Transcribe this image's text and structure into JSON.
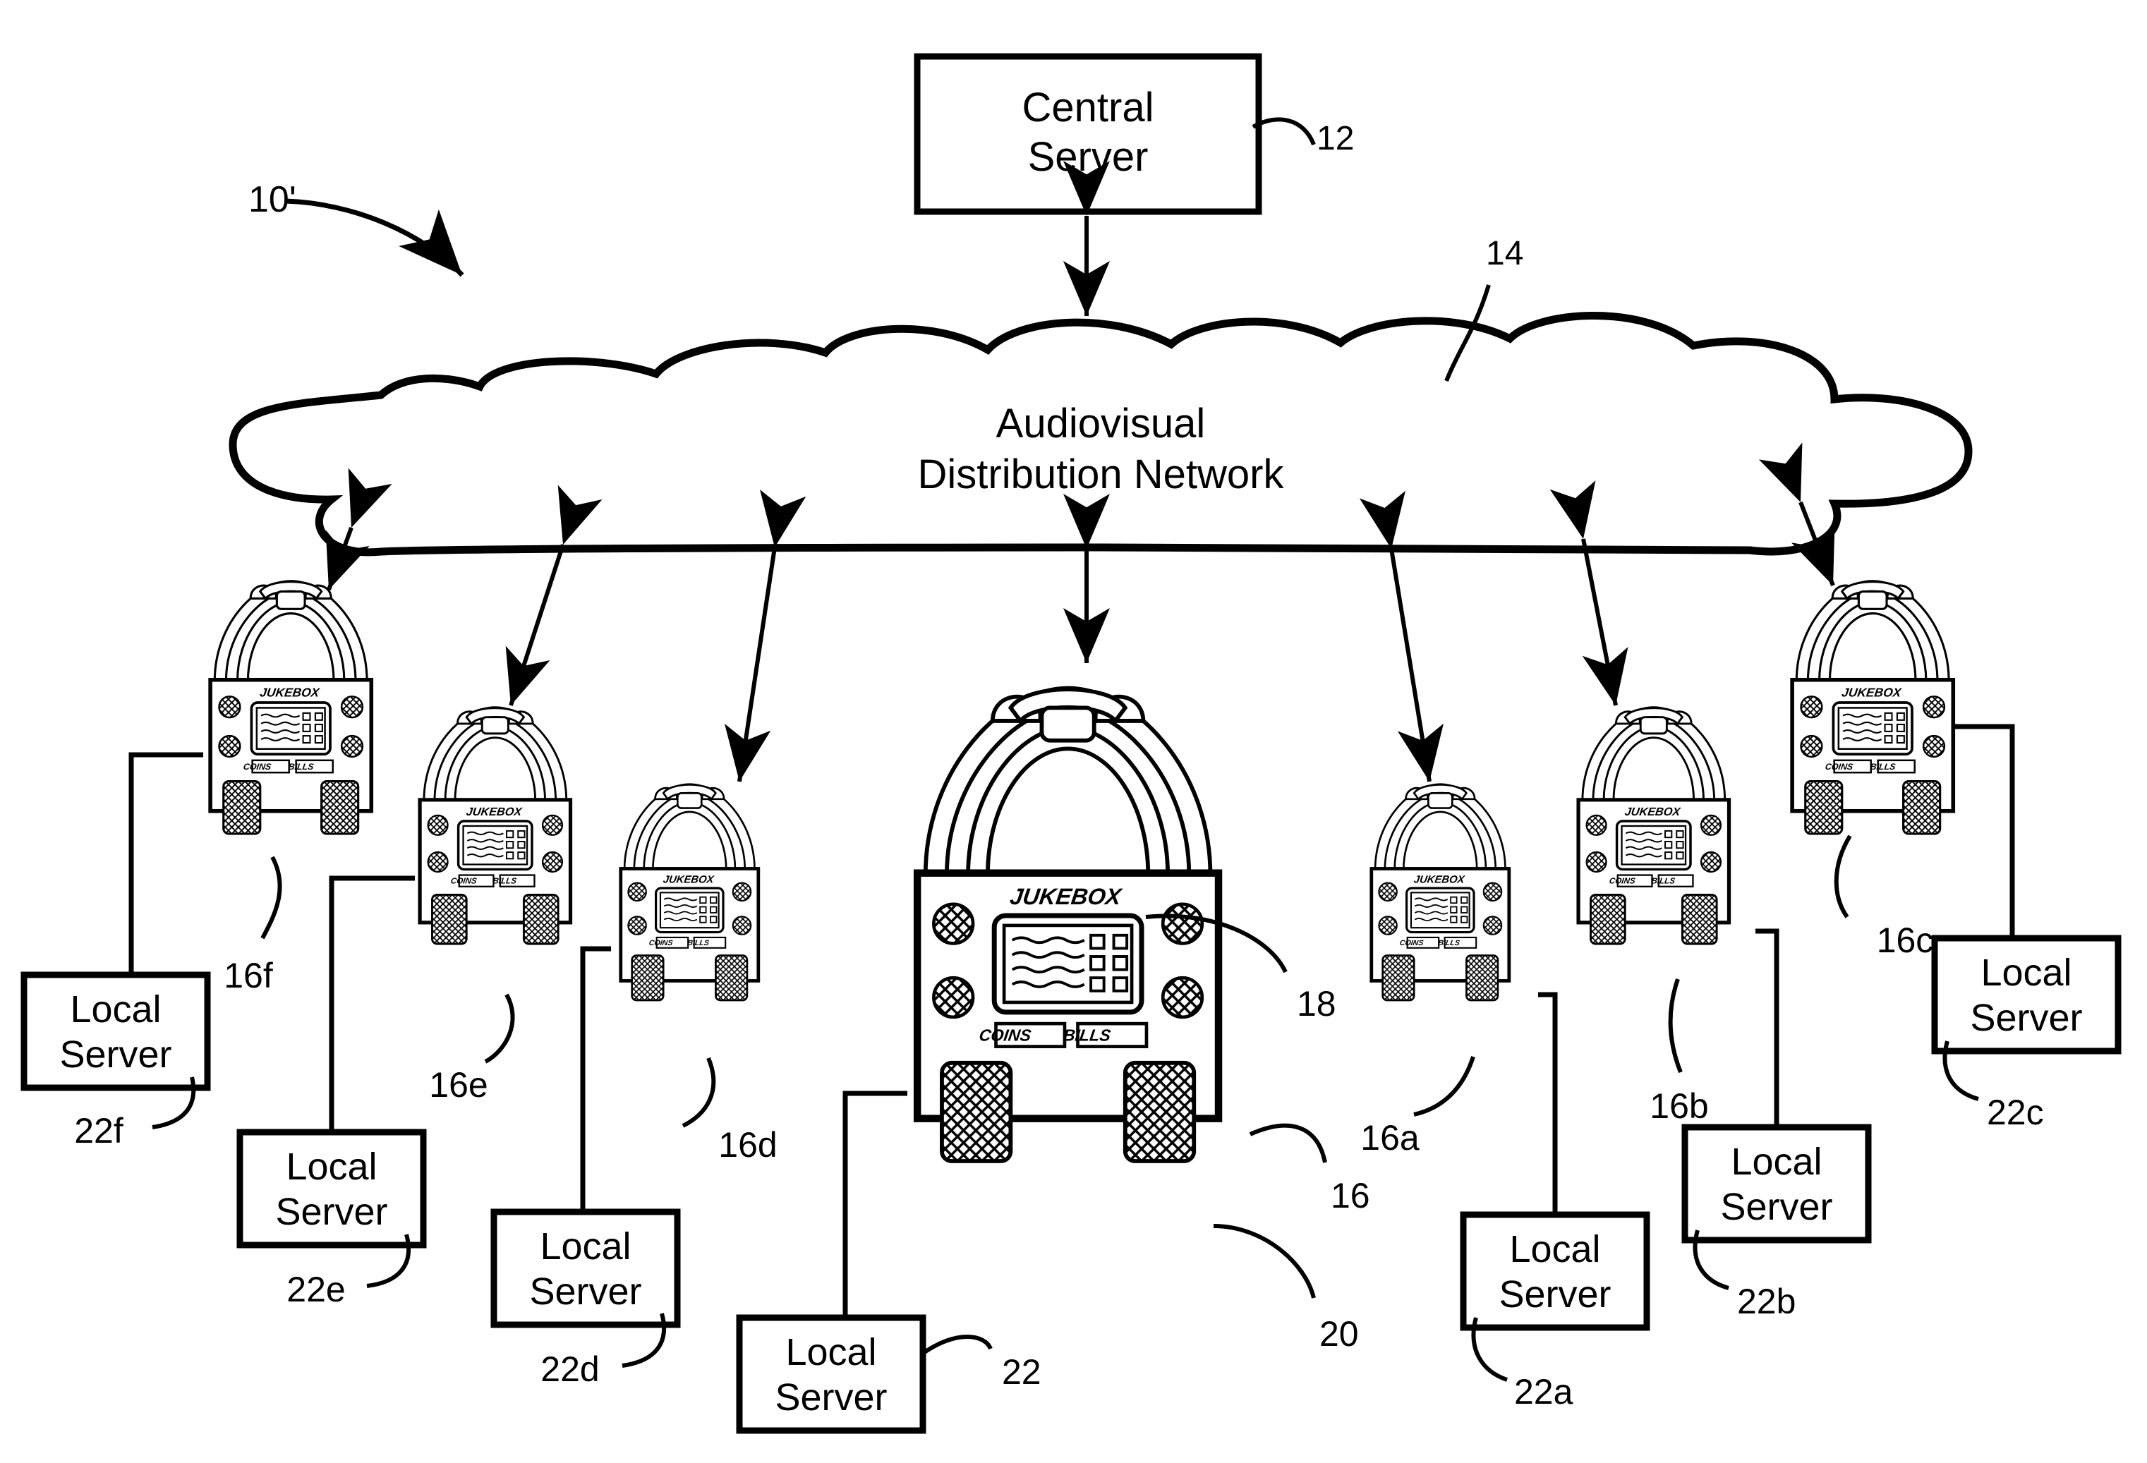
{
  "figure": {
    "system_label": "10'",
    "central_server": {
      "title_line1": "Central",
      "title_line2": "Server",
      "ref": "12"
    },
    "network_cloud": {
      "title_line1": "Audiovisual",
      "title_line2": "Distribution Network",
      "ref": "14"
    },
    "jukebox_face": {
      "brand": "JUKEBOX",
      "coin_slot": "COINS",
      "bill_slot": "BILLS",
      "display_ref": "18",
      "body_ref": "16",
      "grille_ref": "20"
    },
    "local_server": {
      "line1": "Local",
      "line2": "Server"
    },
    "jukeboxes": [
      {
        "ref": "16",
        "size": "large",
        "server_ref": "22"
      },
      {
        "ref": "16a",
        "size": "small",
        "server_ref": "22a"
      },
      {
        "ref": "16b",
        "size": "medium",
        "server_ref": "22b"
      },
      {
        "ref": "16c",
        "size": "medium",
        "server_ref": "22c"
      },
      {
        "ref": "16d",
        "size": "small",
        "server_ref": "22d"
      },
      {
        "ref": "16e",
        "size": "medium",
        "server_ref": "22e"
      },
      {
        "ref": "16f",
        "size": "medium",
        "server_ref": "22f"
      }
    ],
    "local_servers": [
      {
        "ref": "22"
      },
      {
        "ref": "22a"
      },
      {
        "ref": "22b"
      },
      {
        "ref": "22c"
      },
      {
        "ref": "22d"
      },
      {
        "ref": "22e"
      },
      {
        "ref": "22f"
      }
    ],
    "colors": {
      "ink": "#000000",
      "paper": "#ffffff"
    }
  }
}
